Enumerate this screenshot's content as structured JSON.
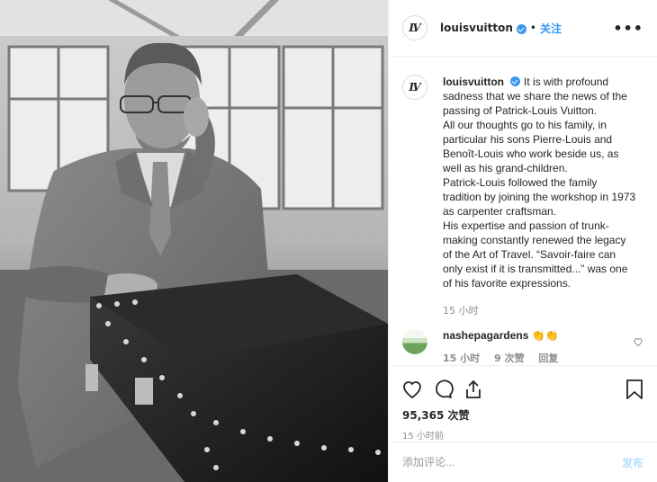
{
  "post": {
    "username": "louisvuitton",
    "follow_label": "关注",
    "dot": "•",
    "more_label": "•••",
    "avatar_logo": "LV",
    "caption_lines": [
      "It is with profound sadness that we share the news of the passing of Patrick-Louis Vuitton.",
      "All our thoughts go to his family, in particular his sons Pierre-Louis and Benoît-Louis who work beside us, as well as his grand-children.",
      "Patrick-Louis followed the family tradition by joining the workshop in 1973 as carpenter craftsman.",
      "His expertise and passion of trunk-making constantly renewed the legacy of the Art of Travel. “Savoir-faire can only exist if it is transmitted...” was one of his favorite expressions."
    ],
    "caption_time": "15 小时",
    "likes": "95,365 次赞",
    "post_time": "15 小时前",
    "colors": {
      "accent": "#3897f0",
      "post_disabled": "#b2dffc",
      "muted": "#8e8e8e"
    }
  },
  "comment": {
    "username": "nashepagardens",
    "text": "👏👏",
    "time": "15 小时",
    "likes": "9 次赞",
    "reply": "回复"
  },
  "add_comment": {
    "placeholder": "添加评论...",
    "post_label": "发布"
  },
  "icons": [
    "heart-icon",
    "comment-icon",
    "share-icon",
    "bookmark-icon",
    "more-icon",
    "verified-badge"
  ]
}
